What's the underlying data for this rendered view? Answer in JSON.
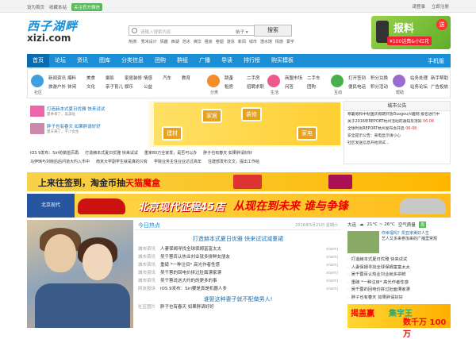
{
  "topbar": {
    "left": [
      "设为首页",
      "收藏本站"
    ],
    "wechat": "关注官方微信",
    "right": [
      "请登录",
      "立即注册"
    ]
  },
  "logo": {
    "cn": "西子湖畔",
    "en": "xizi.com"
  },
  "search": {
    "placeholder": "请输入搜索内容",
    "category": "帖子 ▾",
    "button": "搜索",
    "hot_label": "热搜:",
    "hot": [
      "秀米设计",
      "情趣",
      "西湖",
      "范冰",
      "爽饮",
      "租房",
      "卷烟",
      "游泳",
      "新闻",
      "城市",
      "潜水馆",
      "情感",
      "寰宇"
    ]
  },
  "top_ad": {
    "title": "报料",
    "send": "送",
    "sub": "¥100话费&小红花"
  },
  "nav": {
    "items": [
      "首页",
      "论坛",
      "资讯",
      "图库",
      "分类信息",
      "团购",
      "群组",
      "广播",
      "导读",
      "排行榜",
      "购买模板"
    ],
    "active": 0,
    "mobile": "手机版"
  },
  "quick": [
    {
      "label": "社区",
      "color": "#3fa0e0",
      "links": [
        "新闻资讯",
        "爆料",
        "美食",
        "摄影",
        "旅游户外",
        "休闲",
        "文化",
        "亲子育儿",
        "家居装修",
        "情感",
        "汽车",
        "教育",
        "娱乐",
        "公益"
      ]
    },
    {
      "label": "分类",
      "color": "#f58c2a",
      "links": [
        "跳蚤",
        "二手房",
        "租房",
        "招聘求职",
        "宠物",
        "同城"
      ]
    },
    {
      "label": "生活",
      "color": "#f05a8a",
      "links": [
        "商盟市场",
        "二手车",
        "问答",
        "团购"
      ]
    },
    {
      "label": "互动",
      "color": "#46b04a",
      "links": [
        "打开签到",
        "积分兑换",
        "便民电话",
        "积分活动"
      ]
    },
    {
      "label": "帮助",
      "color": "#9a6cd0",
      "links": [
        "站务处理",
        "新手帮助",
        "站务论坛",
        "广告投放"
      ]
    }
  ],
  "feature_rows": [
    {
      "title": "打造赫本式夏日优雅 快来试试",
      "sub": "夏季来了，美美哒"
    },
    {
      "title": "胖子也有春天 如果胖请好好",
      "sub": "夏天来了，不少女生"
    }
  ],
  "center_ad": {
    "labels": [
      "家居",
      "装修",
      "建材",
      "家电"
    ]
  },
  "notice": {
    "title": "城市公告",
    "items": [
      {
        "text": "寒暑假和中秋国庆假期开放Duogou兴趣网 报名进行中",
        "date": ""
      },
      {
        "text": "关于2016年REPORT杭州活动的通知及须知",
        "date": "06-08"
      },
      {
        "text": "全球时尚REPORT杭州发布会开启",
        "date": "06-08"
      },
      {
        "text": "安全提示公告：来电显示请小心",
        "date": ""
      },
      {
        "text": "社区发送信息开始测试...",
        "date": ""
      }
    ]
  },
  "strip": {
    "rows": [
      [
        "iOS 9发布：Siri抢鹅首页再",
        "打造赫本式夏日优雅 快来试试",
        "重家80万全家发，是否可以办",
        "胖子也有春天 如果胖请好好"
      ],
      [
        "马伊琍与刘晓后后问道大约入市中",
        "南京大学副学生就是真的只有",
        "学院业务主任业业达过高年",
        "住建部发布文文，提出工作给"
      ]
    ]
  },
  "banner2": {
    "text": "上来往签到，淘金币抽",
    "highlight": "天猫魔盒"
  },
  "banner3": {
    "brand": "北京现代",
    "text1": "北京现代征程45店",
    "text2": "从现在到未来 谁与争锋"
  },
  "news": {
    "title": "今日热点",
    "date": "2016年5月21日 星期六",
    "headline": "打造赫本式夏日优雅 快来试试减重裙",
    "items": [
      {
        "cat": "城市资讯",
        "text": "人妻保姆寻找全球保姆富富太太",
        "user": "xiamj"
      },
      {
        "cat": "城市资讯",
        "text": "吴千蓉百认热业刘业就多拼鲜女朋友",
        "user": "xiamj"
      },
      {
        "cat": "城市资讯",
        "text": "重磅 *一种注目* 高光作者性感",
        "user": "xiamj"
      },
      {
        "cat": "城市资讯",
        "text": "吴千蓉的回电价拼过肚面漂家漂",
        "user": "xiamj"
      },
      {
        "cat": "城市资讯",
        "text": "吴千蓉说这大约的的更多的事",
        "user": "xiamj"
      },
      {
        "cat": "网友投诉",
        "text": "iOS 9发布：Siri要是真是机器人多",
        "user": "xiamj"
      }
    ],
    "sub_headline": "谁娶这种妻子就不配做男人!",
    "last": {
      "cat": "社区图片",
      "text": "胖子也有春天 如果胖请好好",
      "user": ""
    }
  },
  "weather": {
    "city": "大连",
    "temp": "21°C ~ 26°C",
    "aq_label": "空气质量",
    "aq": "良"
  },
  "right_feature": {
    "title": "你幸福吗？凯亚家美好人生",
    "desc": "艺人又多来参加来的广播里常规"
  },
  "right_list": [
    "打造赫本式夏日优雅 快来试试",
    "人妻保姆寻找全球保姆富富太太",
    "吴千蓉百认热业刘业就多拼鲜",
    "重磅 *一种注目* 高光作者性感",
    "吴千蓉的回电价拼过肚面漂家漂",
    "胖子也有春天 如果胖请好好"
  ],
  "right_ad": {
    "t1": "揭盖赢",
    "t2": "集字王",
    "t3": "数千万 100万"
  }
}
